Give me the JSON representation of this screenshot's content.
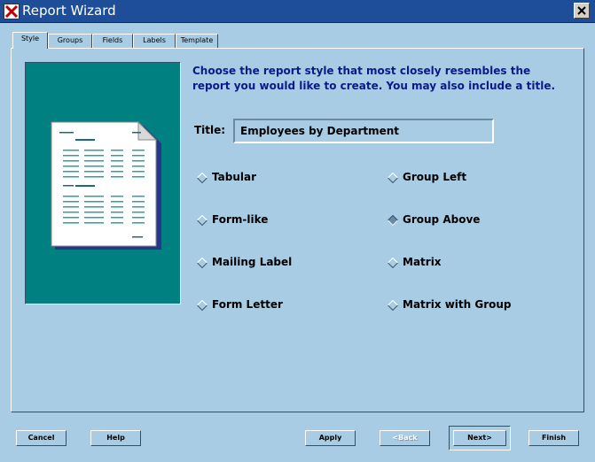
{
  "window": {
    "title": "Report Wizard",
    "close_glyph": "X"
  },
  "tabs": [
    {
      "label": "Style",
      "active": true
    },
    {
      "label": "Groups",
      "active": false
    },
    {
      "label": "Fields",
      "active": false
    },
    {
      "label": "Labels",
      "active": false
    },
    {
      "label": "Template",
      "active": false
    }
  ],
  "main": {
    "instructions": "Choose the report style that most closely resembles the report you would like to create. You may also include a title.",
    "title_label": "Title:",
    "title_value": "Employees by Department",
    "styles": [
      {
        "label": "Tabular",
        "selected": false
      },
      {
        "label": "Group Left",
        "selected": false
      },
      {
        "label": "Form-like",
        "selected": false
      },
      {
        "label": "Group Above",
        "selected": true
      },
      {
        "label": "Mailing Label",
        "selected": false
      },
      {
        "label": "Matrix",
        "selected": false
      },
      {
        "label": "Form Letter",
        "selected": false
      },
      {
        "label": "Matrix with Group",
        "selected": false
      }
    ],
    "preview_icon": "report-preview-document-icon"
  },
  "buttons": {
    "cancel": "Cancel",
    "help": "Help",
    "apply": "Apply",
    "back": "<Back",
    "next": "Next>",
    "finish": "Finish"
  },
  "colors": {
    "background": "#a8cce4",
    "titlebar": "#1f4e98",
    "preview_bg": "#008080",
    "instructions_text": "#0a1a8a"
  }
}
